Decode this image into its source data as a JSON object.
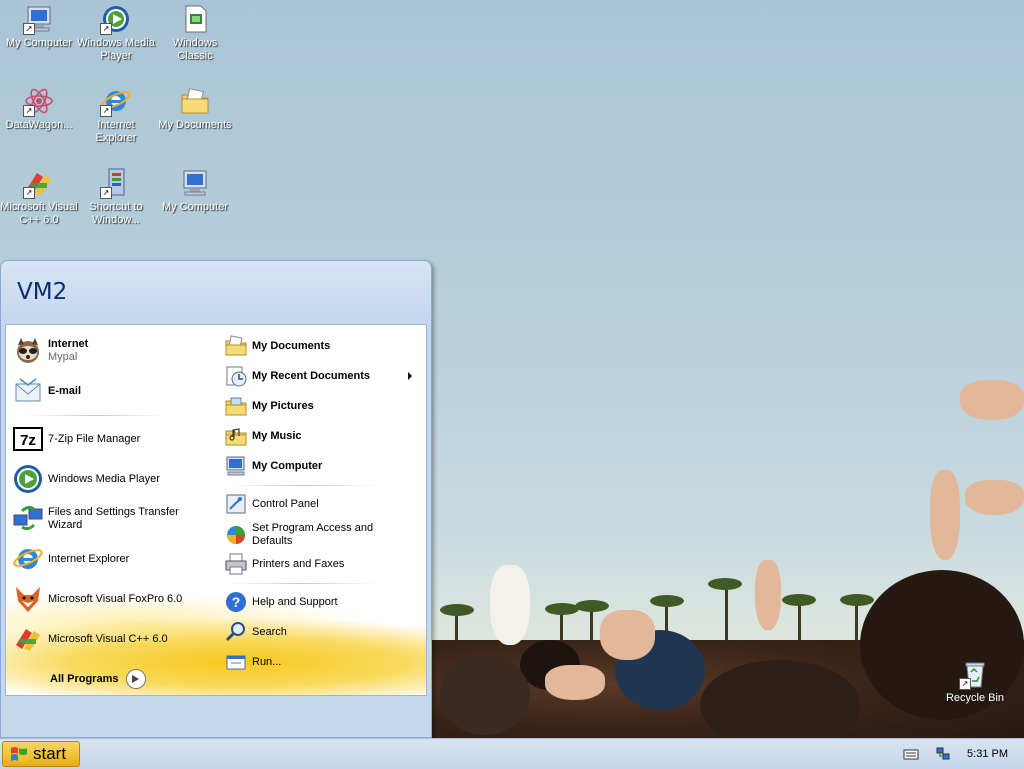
{
  "desktop": {
    "icons": [
      {
        "label": "My Computer",
        "icon": "my-computer-icon",
        "shortcut": true
      },
      {
        "label": "Windows Media Player",
        "icon": "media-player-icon",
        "shortcut": true
      },
      {
        "label": "Windows Classic",
        "icon": "classic-theme-icon",
        "shortcut": false
      },
      {
        "label": "DataWagon...",
        "icon": "datawagon-icon",
        "shortcut": true
      },
      {
        "label": "Internet Explorer",
        "icon": "internet-explorer-icon",
        "shortcut": true
      },
      {
        "label": "My Documents",
        "icon": "my-documents-icon",
        "shortcut": false
      },
      {
        "label": "Microsoft Visual C++ 6.0",
        "icon": "visual-cpp-icon",
        "shortcut": true
      },
      {
        "label": "Shortcut to Window...",
        "icon": "window-shortcut-icon",
        "shortcut": true
      },
      {
        "label": "My Computer",
        "icon": "my-computer-icon",
        "shortcut": false
      }
    ],
    "recycle_bin": {
      "label": "Recycle Bin",
      "icon": "recycle-bin-icon"
    }
  },
  "start_menu": {
    "user": "VM2",
    "left": {
      "pinned": [
        {
          "title": "Internet",
          "subtitle": "Mypal",
          "icon": "mypal-browser-icon"
        },
        {
          "title": "E-mail",
          "subtitle": "",
          "icon": "email-icon"
        }
      ],
      "recent": [
        {
          "label": "7-Zip File Manager",
          "icon": "7zip-icon"
        },
        {
          "label": "Windows Media Player",
          "icon": "media-player-icon"
        },
        {
          "label": "Files and Settings Transfer Wizard",
          "icon": "transfer-wizard-icon"
        },
        {
          "label": "Internet Explorer",
          "icon": "internet-explorer-icon"
        },
        {
          "label": "Microsoft Visual FoxPro 6.0",
          "icon": "foxpro-icon"
        },
        {
          "label": "Microsoft Visual C++ 6.0",
          "icon": "visual-cpp-icon"
        }
      ],
      "all_programs": "All Programs"
    },
    "right": {
      "places": [
        {
          "label": "My Documents",
          "icon": "my-documents-icon",
          "submenu": false
        },
        {
          "label": "My Recent Documents",
          "icon": "recent-documents-icon",
          "submenu": true
        },
        {
          "label": "My Pictures",
          "icon": "my-pictures-icon",
          "submenu": false
        },
        {
          "label": "My Music",
          "icon": "my-music-icon",
          "submenu": false
        },
        {
          "label": "My Computer",
          "icon": "my-computer-icon",
          "submenu": false
        }
      ],
      "settings": [
        {
          "label": "Control Panel",
          "icon": "control-panel-icon"
        },
        {
          "label": "Set Program Access and Defaults",
          "icon": "program-defaults-icon"
        },
        {
          "label": "Printers and Faxes",
          "icon": "printer-icon"
        }
      ],
      "tools": [
        {
          "label": "Help and Support",
          "icon": "help-icon"
        },
        {
          "label": "Search",
          "icon": "search-icon"
        },
        {
          "label": "Run...",
          "icon": "run-icon"
        }
      ]
    }
  },
  "taskbar": {
    "start_label": "start",
    "clock": "5:31 PM",
    "tray_icons": [
      "keyboard-icon",
      "network-icon"
    ]
  }
}
